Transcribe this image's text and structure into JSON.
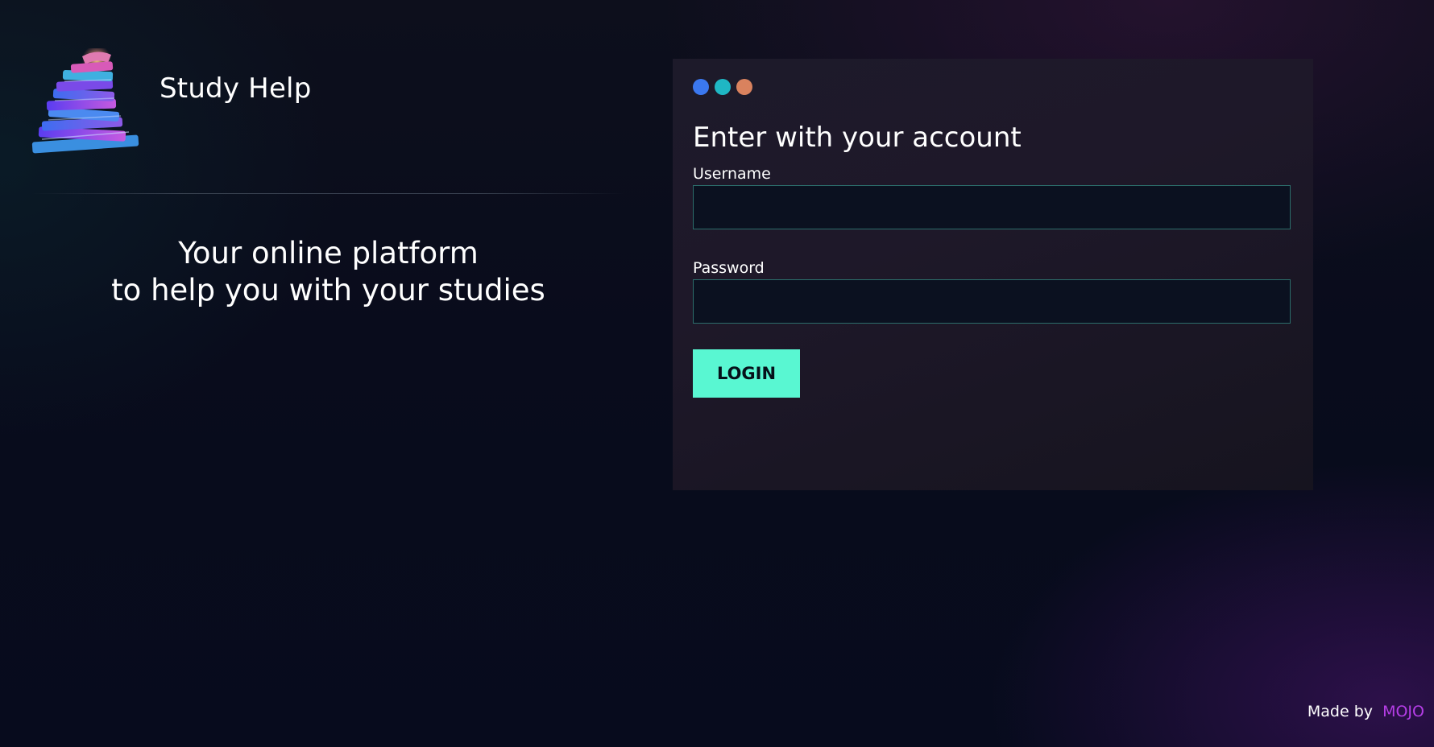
{
  "brand": {
    "name": "Study Help",
    "logo_icon": "stacked-books-icon"
  },
  "tagline": {
    "line1": "Your online platform",
    "line2": "to help you with your studies"
  },
  "login_card": {
    "window_dots": [
      {
        "name": "blue-dot",
        "color": "#3b78f0"
      },
      {
        "name": "teal-dot",
        "color": "#1fb7c4"
      },
      {
        "name": "orange-dot",
        "color": "#d9825e"
      }
    ],
    "title": "Enter with your account",
    "username": {
      "label": "Username",
      "value": "",
      "placeholder": ""
    },
    "password": {
      "label": "Password",
      "value": "",
      "placeholder": ""
    },
    "login_label": "LOGIN"
  },
  "footer": {
    "prefix": "Made by",
    "maker": "MOJO"
  },
  "colors": {
    "accent": "#59f7d2",
    "input_border": "#2c6d6b",
    "maker": "#b53ee6"
  }
}
